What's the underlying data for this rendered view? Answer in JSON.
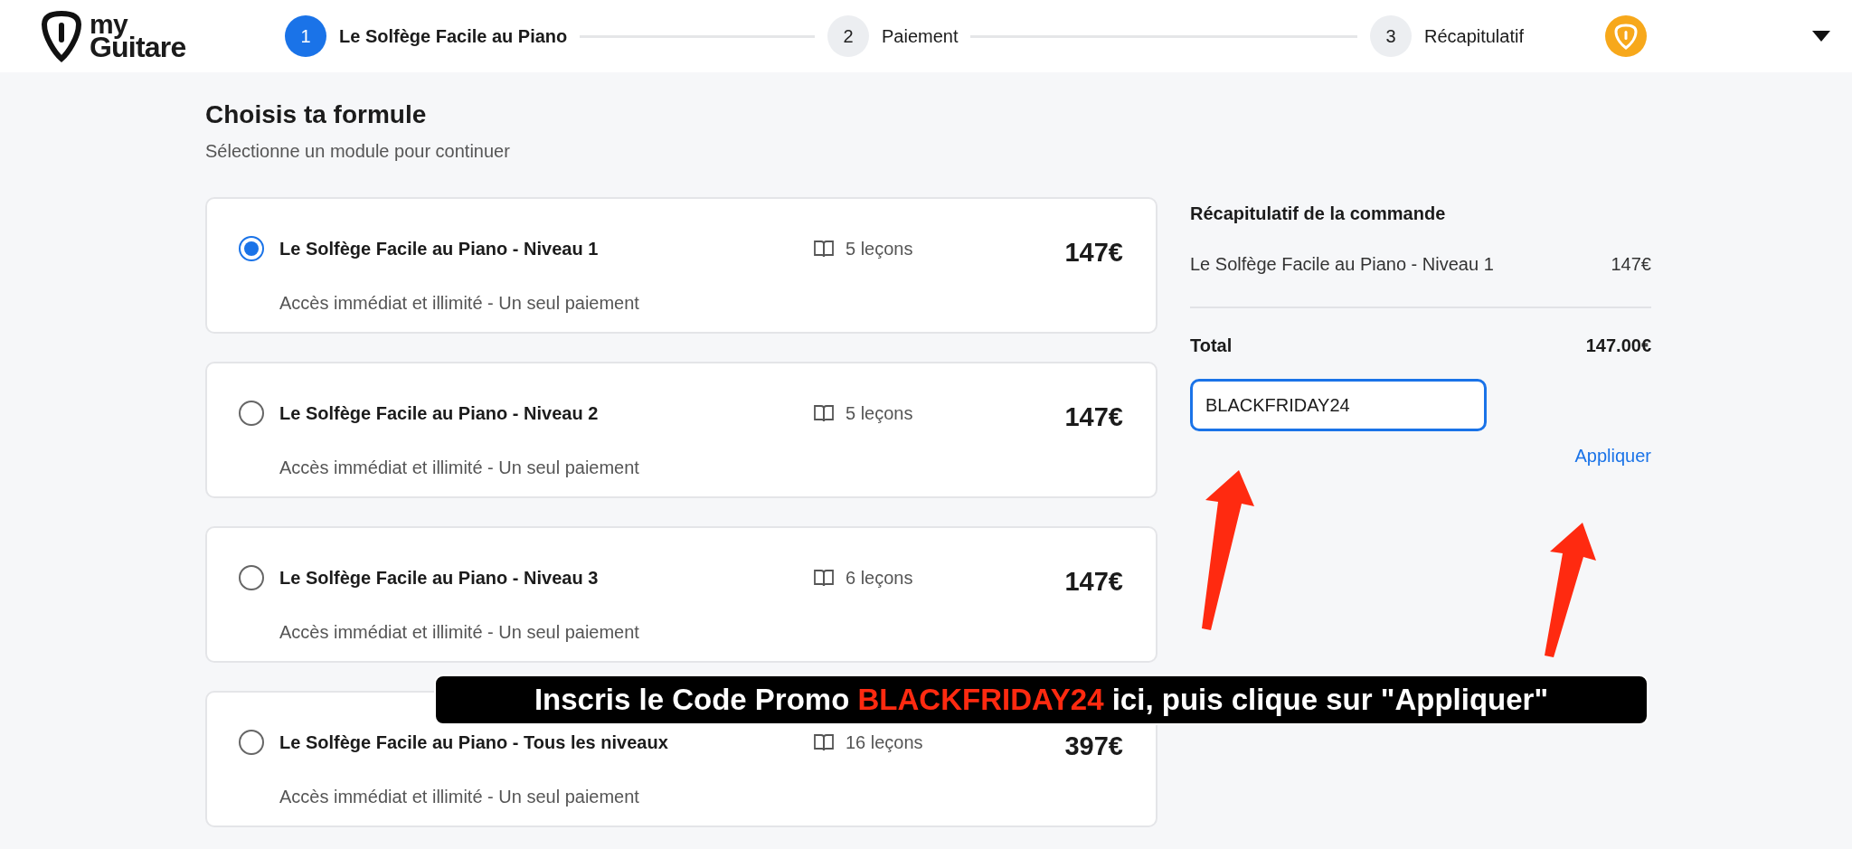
{
  "header": {
    "logo": {
      "line_1": "my",
      "line_2": "Guitare"
    },
    "steps": [
      {
        "number": "1",
        "label": "Le Solfège Facile au Piano",
        "selected": true
      },
      {
        "number": "2",
        "label": "Paiement",
        "selected": false
      },
      {
        "number": "3",
        "label": "Récapitulatif",
        "selected": false
      }
    ]
  },
  "heading": {
    "title": "Choisis ta formule",
    "subtitle": "Sélectionne un module pour continuer"
  },
  "plans": [
    {
      "name": "Le Solfège Facile au Piano - Niveau 1",
      "lessons": "5 leçons",
      "price": "147€",
      "description": "Accès immédiat et illimité - Un seul paiement",
      "selected": true
    },
    {
      "name": "Le Solfège Facile au Piano - Niveau 2",
      "lessons": "5 leçons",
      "price": "147€",
      "description": "Accès immédiat et illimité - Un seul paiement",
      "selected": false
    },
    {
      "name": "Le Solfège Facile au Piano - Niveau 3",
      "lessons": "6 leçons",
      "price": "147€",
      "description": "Accès immédiat et illimité - Un seul paiement",
      "selected": false
    },
    {
      "name": "Le Solfège Facile au Piano - Tous les niveaux",
      "lessons": "16 leçons",
      "price": "397€",
      "description": "Accès immédiat et illimité - Un seul paiement",
      "selected": false
    }
  ],
  "summary": {
    "title": "Récapitulatif de la commande",
    "item": {
      "name": "Le Solfège Facile au Piano - Niveau 1",
      "price": "147€"
    },
    "total_label": "Total",
    "total": "147.00€",
    "promo_value": "BLACKFRIDAY24",
    "apply": "Appliquer"
  },
  "banner": {
    "parts": [
      {
        "text": "Inscris le Code Promo ",
        "highlight": false
      },
      {
        "text": "BLACKFRIDAY24",
        "highlight": true
      },
      {
        "text": " ici, puis clique sur \"Appliquer\"",
        "highlight": false
      }
    ]
  }
}
